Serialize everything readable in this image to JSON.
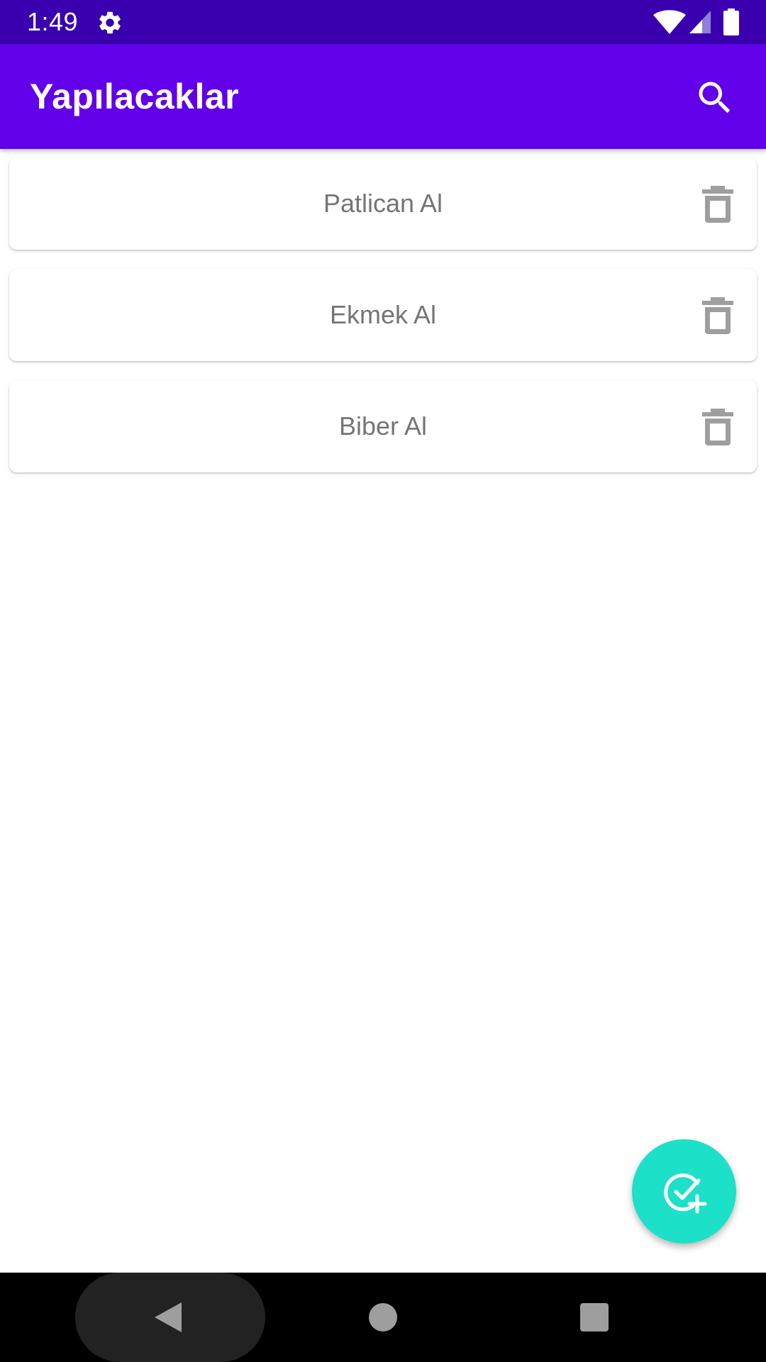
{
  "status_bar": {
    "time": "1:49",
    "icons": [
      "gear-icon",
      "wifi-icon",
      "signal-icon",
      "battery-icon"
    ]
  },
  "app_bar": {
    "title": "Yapılacaklar",
    "search_icon": "search-icon"
  },
  "todos": [
    {
      "label": "Patlican Al"
    },
    {
      "label": "Ekmek Al"
    },
    {
      "label": "Biber Al"
    }
  ],
  "fab": {
    "icon": "add-task-icon"
  },
  "nav_bar": {
    "icons": [
      "back-icon",
      "home-icon",
      "recents-icon"
    ]
  },
  "colors": {
    "status_bar": "#3a00b0",
    "app_bar": "#6200ea",
    "fab": "#1de0c8",
    "item_text": "#757575",
    "trash_icon": "#9e9e9e"
  }
}
